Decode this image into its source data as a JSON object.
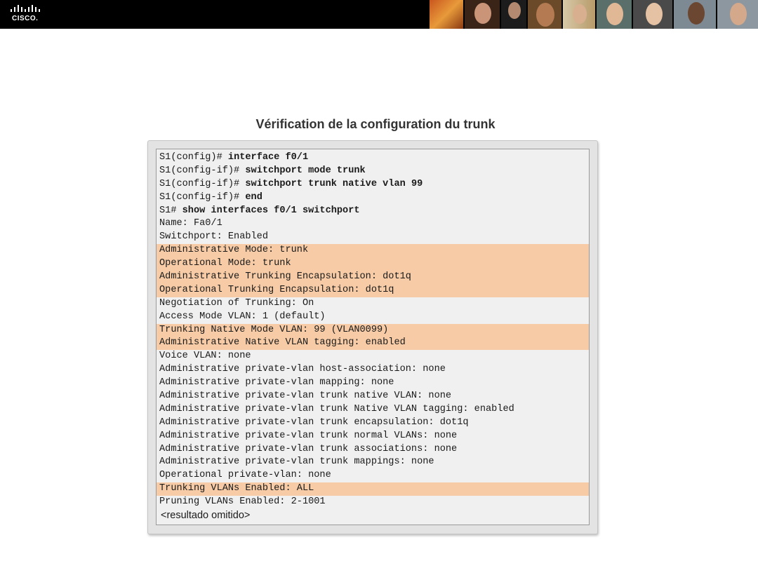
{
  "header": {
    "logo_text": "CISCO.",
    "photo_count": 9
  },
  "colors": {
    "banner": "#000000",
    "highlight": "#f6cba6",
    "terminal_bg": "#f0f0f0"
  },
  "slide": {
    "title": "Vérification de la configuration du trunk"
  },
  "terminal": {
    "lines": [
      {
        "prompt": "S1(config)# ",
        "command": "interface f0/1",
        "highlight": false
      },
      {
        "prompt": "S1(config-if)# ",
        "command": "switchport mode trunk",
        "highlight": false
      },
      {
        "prompt": "S1(config-if)# ",
        "command": "switchport trunk native vlan 99",
        "highlight": false
      },
      {
        "prompt": "S1(config-if)# ",
        "command": "end",
        "highlight": false
      },
      {
        "prompt": "S1# ",
        "command": "show interfaces f0/1 switchport",
        "highlight": false
      },
      {
        "text": "Name: Fa0/1",
        "highlight": false
      },
      {
        "text": "Switchport: Enabled",
        "highlight": false
      },
      {
        "text": "Administrative Mode: trunk",
        "highlight": true
      },
      {
        "text": "Operational Mode: trunk",
        "highlight": true
      },
      {
        "text": "Administrative Trunking Encapsulation: dot1q",
        "highlight": true
      },
      {
        "text": "Operational Trunking Encapsulation: dot1q",
        "highlight": true
      },
      {
        "text": "Negotiation of Trunking: On",
        "highlight": false
      },
      {
        "text": "Access Mode VLAN: 1 (default)",
        "highlight": false
      },
      {
        "text": "Trunking Native Mode VLAN: 99 (VLAN0099)",
        "highlight": true
      },
      {
        "text": "Administrative Native VLAN tagging: enabled",
        "highlight": true
      },
      {
        "text": "Voice VLAN: none",
        "highlight": false
      },
      {
        "text": "Administrative private-vlan host-association: none",
        "highlight": false
      },
      {
        "text": "Administrative private-vlan mapping: none",
        "highlight": false
      },
      {
        "text": "Administrative private-vlan trunk native VLAN: none",
        "highlight": false
      },
      {
        "text": "Administrative private-vlan trunk Native VLAN tagging: enabled",
        "highlight": false
      },
      {
        "text": "Administrative private-vlan trunk encapsulation: dot1q",
        "highlight": false
      },
      {
        "text": "Administrative private-vlan trunk normal VLANs: none",
        "highlight": false
      },
      {
        "text": "Administrative private-vlan trunk associations: none",
        "highlight": false
      },
      {
        "text": "Administrative private-vlan trunk mappings: none",
        "highlight": false
      },
      {
        "text": "Operational private-vlan: none",
        "highlight": false
      },
      {
        "text": "Trunking VLANs Enabled: ALL",
        "highlight": true
      },
      {
        "text": "Pruning VLANs Enabled: 2-1001",
        "highlight": false
      },
      {
        "text": "<resultado omitido>",
        "highlight": false,
        "sans": true
      }
    ]
  }
}
